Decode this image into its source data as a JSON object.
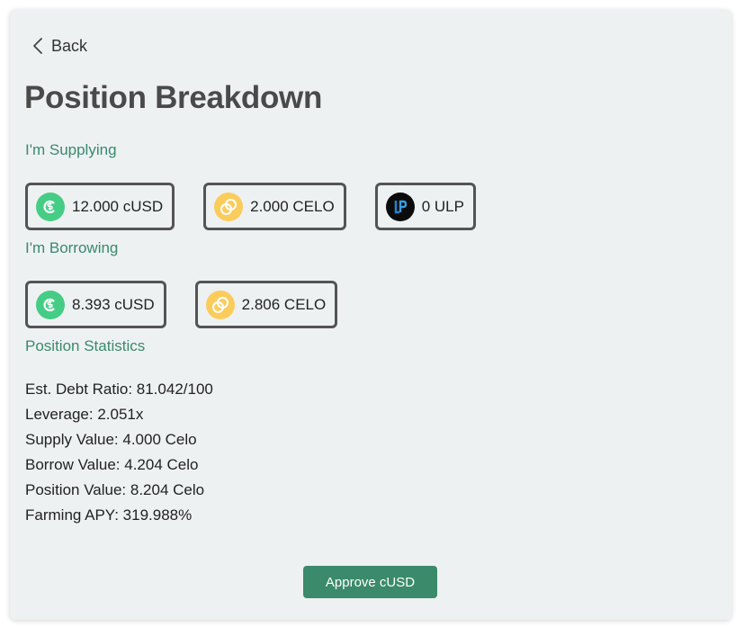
{
  "nav": {
    "back_label": "Back"
  },
  "page": {
    "title": "Position Breakdown"
  },
  "supplying": {
    "label": "I'm Supplying",
    "tokens": [
      {
        "amount": "12.000 cUSD",
        "icon": "cusd-icon"
      },
      {
        "amount": "2.000 CELO",
        "icon": "celo-icon"
      },
      {
        "amount": "0 ULP",
        "icon": "ulp-icon"
      }
    ]
  },
  "borrowing": {
    "label": "I'm Borrowing",
    "tokens": [
      {
        "amount": "8.393 cUSD",
        "icon": "cusd-icon"
      },
      {
        "amount": "2.806 CELO",
        "icon": "celo-icon"
      }
    ]
  },
  "statistics": {
    "label": "Position Statistics",
    "lines": [
      "Est. Debt Ratio: 81.042/100",
      "Leverage: 2.051x",
      "Supply Value: 4.000 Celo",
      "Borrow Value: 4.204 Celo",
      "Position Value: 8.204 Celo",
      "Farming APY: 319.988%"
    ]
  },
  "actions": {
    "approve_label": "Approve cUSD"
  },
  "colors": {
    "accent": "#3a8a6b",
    "cusd": "#45cd85",
    "celo": "#fbcc5c",
    "ulp": "#0b0b0b",
    "background": "#eef1f2"
  }
}
